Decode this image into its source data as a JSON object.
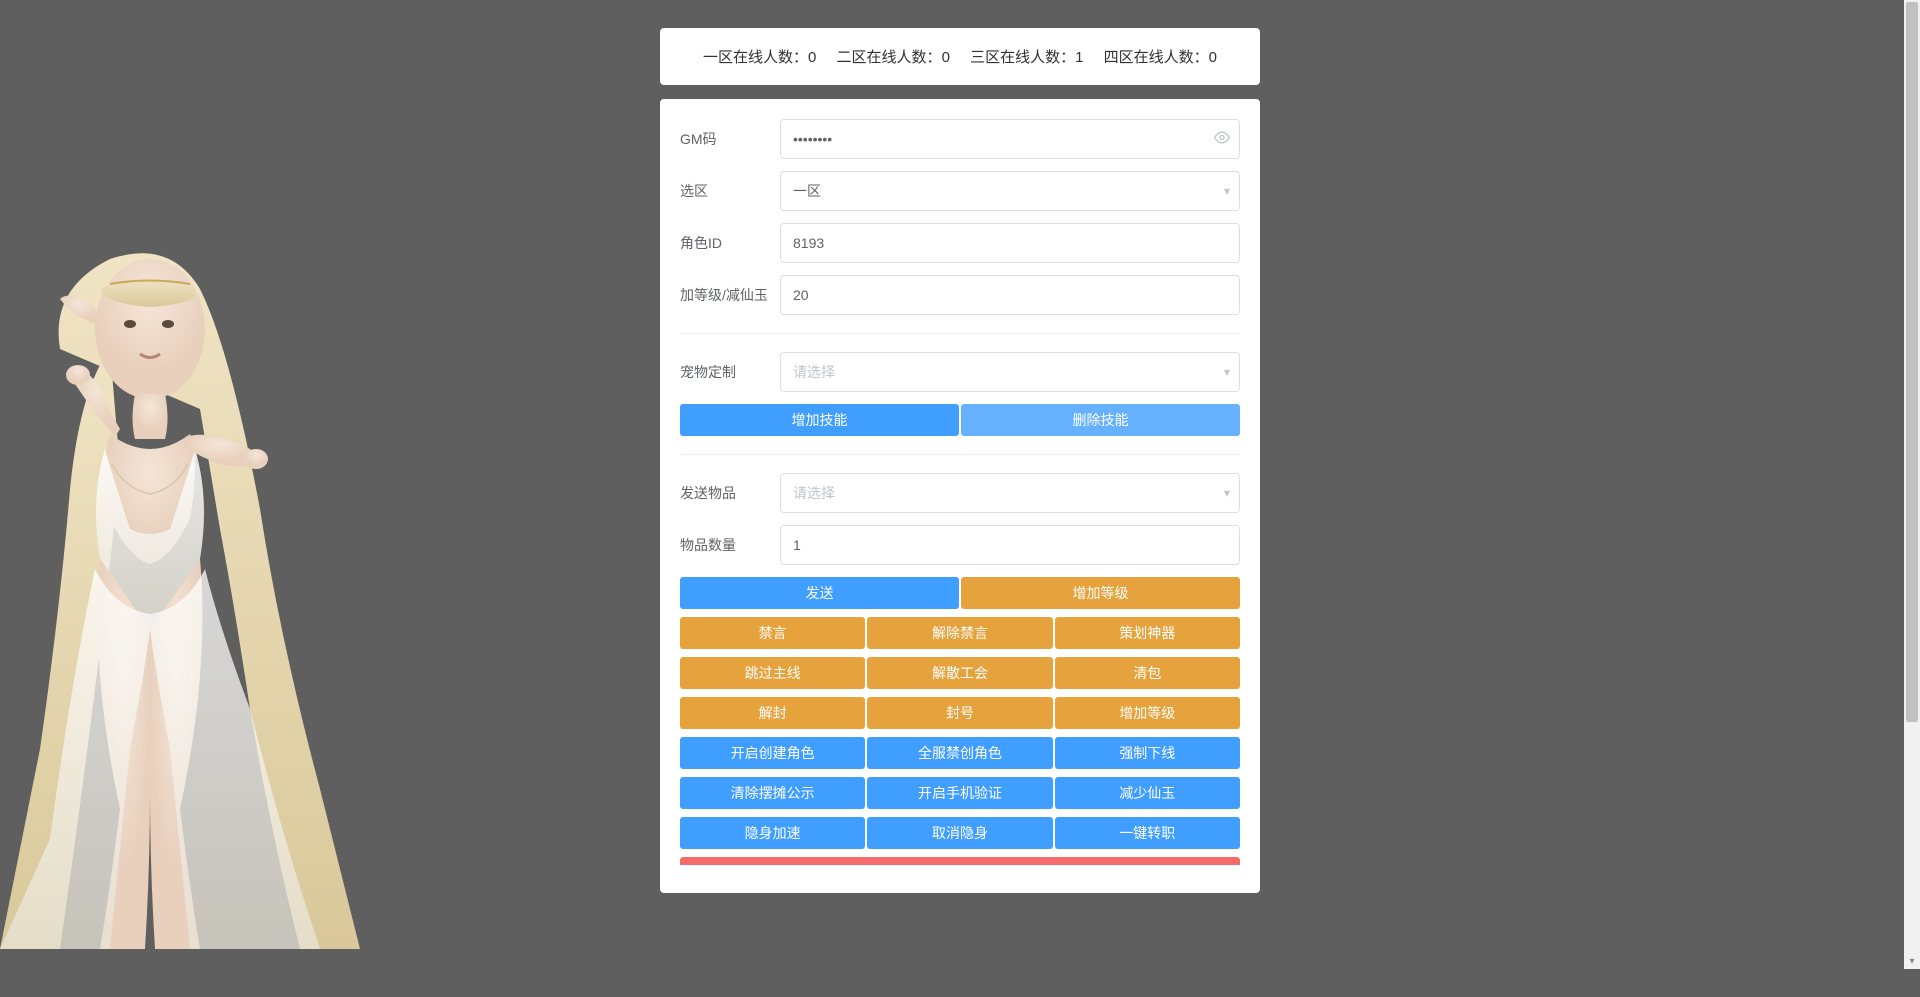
{
  "status": {
    "zones": [
      {
        "label": "一区在线人数：",
        "value": "0"
      },
      {
        "label": "二区在线人数：",
        "value": "0"
      },
      {
        "label": "三区在线人数：",
        "value": "1"
      },
      {
        "label": "四区在线人数：",
        "value": "0"
      }
    ]
  },
  "form": {
    "gm_code": {
      "label": "GM码",
      "value": "••••••••"
    },
    "zone": {
      "label": "选区",
      "value": "一区"
    },
    "role_id": {
      "label": "角色ID",
      "value": "8193"
    },
    "level_jade": {
      "label": "加等级/减仙玉",
      "value": "20"
    },
    "pet_custom": {
      "label": "宠物定制",
      "placeholder": "请选择"
    },
    "add_skill": "增加技能",
    "del_skill": "删除技能",
    "send_item": {
      "label": "发送物品",
      "placeholder": "请选择"
    },
    "item_count": {
      "label": "物品数量",
      "value": "1"
    }
  },
  "buttons": {
    "row1": [
      "发送",
      "增加等级"
    ],
    "row2": [
      "禁言",
      "解除禁言",
      "策划神器"
    ],
    "row3": [
      "跳过主线",
      "解散工会",
      "清包"
    ],
    "row4": [
      "解封",
      "封号",
      "增加等级"
    ],
    "row5": [
      "开启创建角色",
      "全服禁创角色",
      "强制下线"
    ],
    "row6": [
      "清除摆摊公示",
      "开启手机验证",
      "减少仙玉"
    ],
    "row7": [
      "隐身加速",
      "取消隐身",
      "一键转职"
    ]
  }
}
